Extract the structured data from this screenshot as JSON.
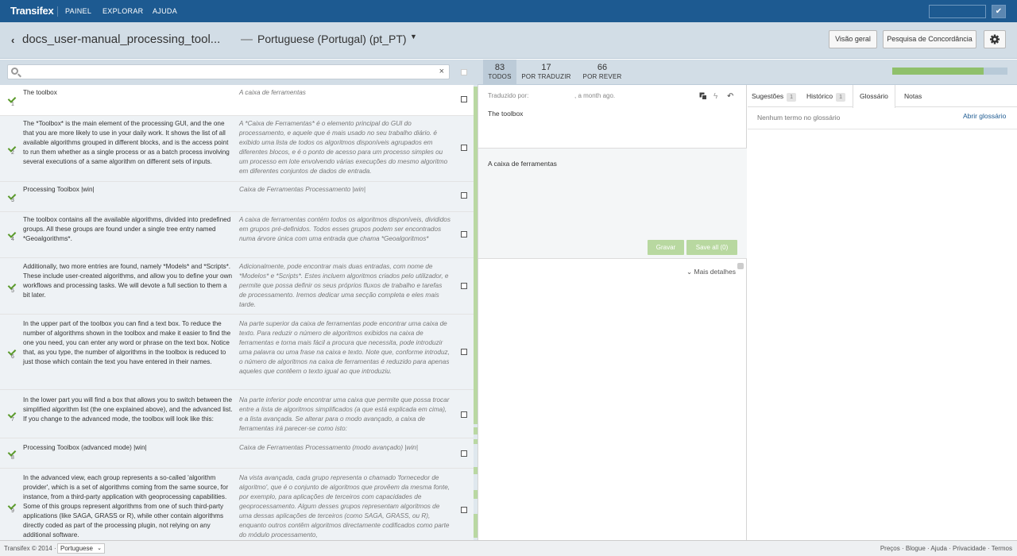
{
  "topbar": {
    "logo": "Transifex",
    "nav": [
      "PAINEL",
      "EXPLORAR",
      "AJUDA"
    ],
    "check_icon": "check-icon"
  },
  "header": {
    "project_title": "docs_user-manual_processing_tool...",
    "separator": "—",
    "language": "Portuguese (Portugal) (pt_PT)",
    "buttons": {
      "overview": "Visão geral",
      "concordance": "Pesquisa de Concordância"
    }
  },
  "filter": {
    "search_value": ""
  },
  "counts": [
    {
      "num": "83",
      "label": "TODOS"
    },
    {
      "num": "17",
      "label": "POR TRADUZIR"
    },
    {
      "num": "66",
      "label": "POR REVER"
    }
  ],
  "progress": {
    "translated_fraction": 0.79,
    "colors": {
      "done": "#8fc06b",
      "rest": "#b8cad8"
    }
  },
  "strings": [
    {
      "n": "1",
      "source": "The toolbox",
      "target": "A caixa de ferramentas"
    },
    {
      "n": "2",
      "source": "The *Toolbox* is the main element of the processing GUI, and the one that you are more likely to use in your daily work. It shows the list of all available algorithms grouped in different blocks, and is the access point to run them whether as a single process or as a batch process involving several executions of a same algorithm on different sets of inputs.",
      "target": "A *Caixa de Ferramentas* é o elemento principal do GUI do processamento, e aquele que é mais usado no seu trabalho diário. é exibido uma lista de todos os algoritmos disponíveis agrupados em diferentes blocos, e é o ponto de acesso para um processo simples ou um processo em lote envolvendo várias execuções do mesmo algoritmo em diferentes conjuntos de dados de entrada."
    },
    {
      "n": "3",
      "source": "Processing Toolbox |win|",
      "target": "Caixa de Ferramentas Processamento |win|"
    },
    {
      "n": "4",
      "source": "The toolbox contains all the available algorithms, divided into predefined groups. All these groups are found under a single tree entry named *Geoalgorithms*.",
      "target": "A caixa de ferramentas contém todos os algoritmos disponíveis, divididos em grupos pré-definidos. Todos esses grupos podem ser encontrados numa árvore única com uma entrada que chama *Geoalgoritmos*"
    },
    {
      "n": "5",
      "source": "Additionally, two more entries are found, namely *Models* and *Scripts*. These include user-created algorithms, and allow you to define your own workflows and processing tasks. We will devote a full section to them a bit later.",
      "target": "Adicionalmente, pode encontrar mais duas entradas, com nome de *Modelos* e *Scripts*. Estes incluem algoritmos criados pelo utilizador, e permite que possa definir os seus próprios fluxos de trabalho e tarefas de processamento. Iremos dedicar uma secção completa e eles mais tarde."
    },
    {
      "n": "6",
      "source": "In the upper part of the toolbox you can find a text box. To reduce the number of algorithms shown in the toolbox and make it easier to find the one you need, you can enter any word or phrase on the text box. Notice that, as you type, the number of algorithms in the toolbox is reduced to just those which contain the text you have entered in their names.",
      "target": "Na parte superior da caixa de ferramentas pode encontrar uma caixa de texto. Para reduzir o número de algoritmos exibidos na caixa de ferramentas e torna mais fácil a procura que necessita, pode introduzir uma palavra ou uma frase na caixa e texto. Note que, conforme introduz, o número de algoritmos na caixa de ferramentas é reduzido para apenas aqueles que contêem o texto igual ao que introduziu."
    },
    {
      "n": "7",
      "source": "In the lower part you will find a box that allows you to switch between the simplified algorithm list (the one explained above), and the advanced list. If you change to the advanced mode, the toolbox will look like this:",
      "target": "Na parte inferior pode encontrar uma caixa que permite que possa trocar entre a lista de algoritmos simplificados (a que está explicada em cima), e a lista avançada. Se alterar para o modo avançado, a caixa de ferramentas irá parecer-se como isto:"
    },
    {
      "n": "8",
      "source": "Processing Toolbox (advanced mode) |win|",
      "target": "Caixa de Ferramentas Processamento (modo avançado) |win|"
    },
    {
      "n": "9",
      "source": "In the advanced view, each group represents a so-called 'algorithm provider', which is a set of algorithms coming from the same source, for instance, from a third-party application with geoprocessing capabilities. Some of this groups represent algorithms from one of such third-party applications (like SAGA, GRASS or R), while other contain algorithms directly coded as part of the processing plugin, not relying on any additional software.",
      "target": "Na vista avançada, cada grupo representa o chamado 'fornecedor de algoritmo', que é o conjunto de algoritmos que provêem da mesma fonte, por exemplo, para aplicações de terceiros com capacidades de geoprocessamento. Algum desses grupos representam algoritmos de uma dessas aplicações de terceiros (como SAGA, GRASS, ou R), enquanto outros contêm algoritmos directamente codificados como parte do módulo processamento,"
    }
  ],
  "editor": {
    "translated_by": "Traduzido por:",
    "ago": ", a month ago.",
    "source": "The toolbox",
    "translation": "A caixa de ferramentas",
    "save": "Gravar",
    "save_all": "Save all (0)",
    "more_details": "Mais detalhes"
  },
  "sidepanel": {
    "tabs": [
      {
        "label": "Sugestões",
        "badge": "1"
      },
      {
        "label": "Histórico",
        "badge": "1"
      },
      {
        "label": "Glossário",
        "badge": ""
      },
      {
        "label": "Notas",
        "badge": ""
      }
    ],
    "glossary_empty": "Nenhum termo no glossário",
    "open_glossary": "Abrir glossário"
  },
  "footer": {
    "copyright": "Transifex © 2014 ·",
    "language": "Portuguese",
    "links": "Preços · Blogue · Ajuda · Privacidade · Termos"
  }
}
